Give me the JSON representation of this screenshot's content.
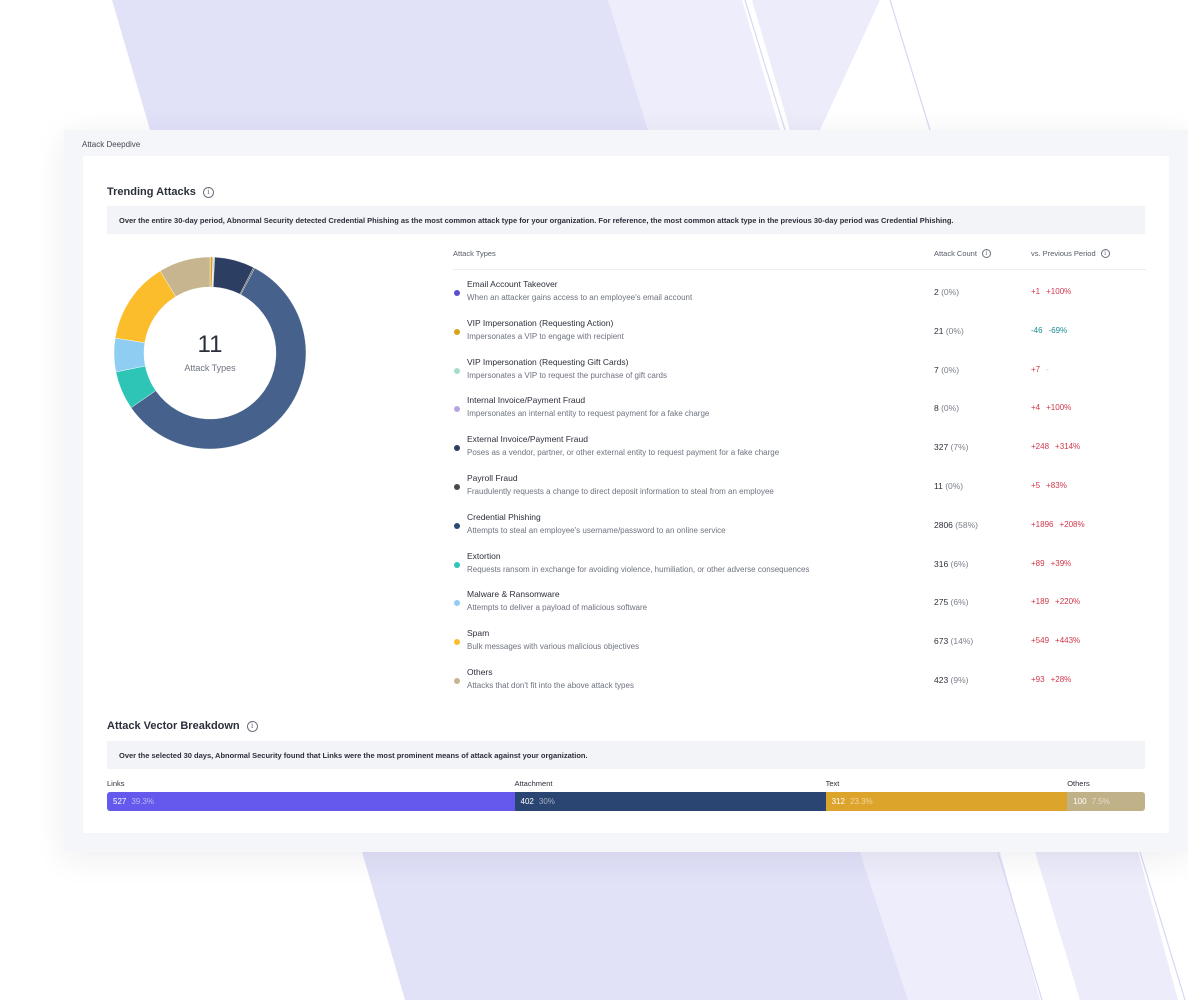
{
  "panel_title": "Attack Deepdive",
  "trending": {
    "title": "Trending Attacks",
    "summary": "Over the entire 30-day period, Abnormal Security detected Credential Phishing as the most common attack type for your organization. For reference, the most common attack type in the previous 30-day period was Credential Phishing.",
    "total_count": "11",
    "total_label": "Attack Types",
    "columns": {
      "type": "Attack Types",
      "count": "Attack Count",
      "prev": "vs. Previous Period"
    },
    "rows": [
      {
        "name": "Email Account Takeover",
        "desc": "When an attacker gains access to an employee's email account",
        "count": "2",
        "pct": "(0%)",
        "delta_abs": "+1",
        "delta_pct": "+100%",
        "trend": "pos",
        "color": "#5b4fd0",
        "value": 2
      },
      {
        "name": "VIP Impersonation (Requesting Action)",
        "desc": "Impersonates a VIP to engage with recipient",
        "count": "21",
        "pct": "(0%)",
        "delta_abs": "-46",
        "delta_pct": "-69%",
        "trend": "neg",
        "color": "#d9a21b",
        "value": 21
      },
      {
        "name": "VIP Impersonation (Requesting Gift Cards)",
        "desc": "Impersonates a VIP to request the purchase of gift cards",
        "count": "7",
        "pct": "(0%)",
        "delta_abs": "+7",
        "delta_pct": "-",
        "trend": "pos",
        "color": "#a8dcc9",
        "value": 7
      },
      {
        "name": "Internal Invoice/Payment Fraud",
        "desc": "Impersonates an internal entity to request payment for a fake charge",
        "count": "8",
        "pct": "(0%)",
        "delta_abs": "+4",
        "delta_pct": "+100%",
        "trend": "pos",
        "color": "#b6a5e0",
        "value": 8
      },
      {
        "name": "External Invoice/Payment Fraud",
        "desc": "Poses as a vendor, partner, or other external entity to request payment for a fake charge",
        "count": "327",
        "pct": "(7%)",
        "delta_abs": "+248",
        "delta_pct": "+314%",
        "trend": "pos",
        "color": "#2c3f63",
        "value": 327
      },
      {
        "name": "Payroll Fraud",
        "desc": "Fraudulently requests a change to direct deposit information to steal from an employee",
        "count": "11",
        "pct": "(0%)",
        "delta_abs": "+5",
        "delta_pct": "+83%",
        "trend": "pos",
        "color": "#4a4a4a",
        "value": 11
      },
      {
        "name": "Credential Phishing",
        "desc": "Attempts to steal an employee's username/password to an online service",
        "count": "2806",
        "pct": "(58%)",
        "delta_abs": "+1896",
        "delta_pct": "+208%",
        "trend": "pos",
        "color": "#2c4a73",
        "value": 2806
      },
      {
        "name": "Extortion",
        "desc": "Requests ransom in exchange for avoiding violence, humiliation, or other adverse consequences",
        "count": "316",
        "pct": "(6%)",
        "delta_abs": "+89",
        "delta_pct": "+39%",
        "trend": "pos",
        "color": "#2ec4b6",
        "value": 316
      },
      {
        "name": "Malware & Ransomware",
        "desc": "Attempts to deliver a payload of malicious software",
        "count": "275",
        "pct": "(6%)",
        "delta_abs": "+189",
        "delta_pct": "+220%",
        "trend": "pos",
        "color": "#8fcdf2",
        "value": 275
      },
      {
        "name": "Spam",
        "desc": "Bulk messages with various malicious objectives",
        "count": "673",
        "pct": "(14%)",
        "delta_abs": "+549",
        "delta_pct": "+443%",
        "trend": "pos",
        "color": "#fbbd2c",
        "value": 673
      },
      {
        "name": "Others",
        "desc": "Attacks that don't fit into the above attack types",
        "count": "423",
        "pct": "(9%)",
        "delta_abs": "+93",
        "delta_pct": "+28%",
        "trend": "pos",
        "color": "#c6b58e",
        "value": 423
      }
    ]
  },
  "chart_data": {
    "type": "pie",
    "categories": [
      "Email Account Takeover",
      "VIP Impersonation (Requesting Action)",
      "VIP Impersonation (Requesting Gift Cards)",
      "Internal Invoice/Payment Fraud",
      "External Invoice/Payment Fraud",
      "Payroll Fraud",
      "Credential Phishing",
      "Extortion",
      "Malware & Ransomware",
      "Spam",
      "Others"
    ],
    "values": [
      2,
      21,
      7,
      8,
      327,
      11,
      2806,
      316,
      275,
      673,
      423
    ],
    "center_value": "11",
    "center_label": "Attack Types"
  },
  "vector": {
    "title": "Attack Vector Breakdown",
    "summary": "Over the selected 30 days, Abnormal Security found that Links were the most prominent means of attack against your organization.",
    "segments": [
      {
        "label": "Links",
        "count": "527",
        "pct": "39.3%",
        "value": 39.3,
        "color": "#6459ec"
      },
      {
        "label": "Attachment",
        "count": "402",
        "pct": "30%",
        "value": 30,
        "color": "#2b4572"
      },
      {
        "label": "Text",
        "count": "312",
        "pct": "23.3%",
        "value": 23.3,
        "color": "#dda42b"
      },
      {
        "label": "Others",
        "count": "100",
        "pct": "7.5%",
        "value": 7.5,
        "color": "#c1b188"
      }
    ]
  }
}
